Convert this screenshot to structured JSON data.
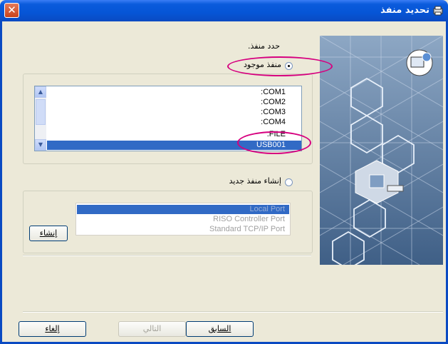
{
  "window": {
    "title": "تحديد منفذ",
    "close_glyph": "✕"
  },
  "prompt": "حدد منفذ.",
  "existing_port": {
    "label": "منفذ موجود",
    "selected": true,
    "ports": [
      ":COM1",
      ":COM2",
      ":COM3",
      ":COM4",
      ":FILE",
      "USB001"
    ],
    "selected_port": "USB001"
  },
  "new_port": {
    "label": "إنشاء منفذ جديد",
    "selected": false,
    "types": [
      "Local Port",
      "RISO Controller Port",
      "Standard TCP/IP Port"
    ],
    "create_button": "إنشاء"
  },
  "footer": {
    "cancel": "إلغاء",
    "next": "التالي",
    "back": "السابق"
  },
  "icons": {
    "close": "close-icon",
    "title": "printer-port-icon",
    "wizard": "wizard-computer-icon"
  },
  "colors": {
    "titlebar": "#0655d6",
    "selection": "#316ac5",
    "highlight_oval": "#d6007f",
    "art_bg": "#6b87a8"
  }
}
